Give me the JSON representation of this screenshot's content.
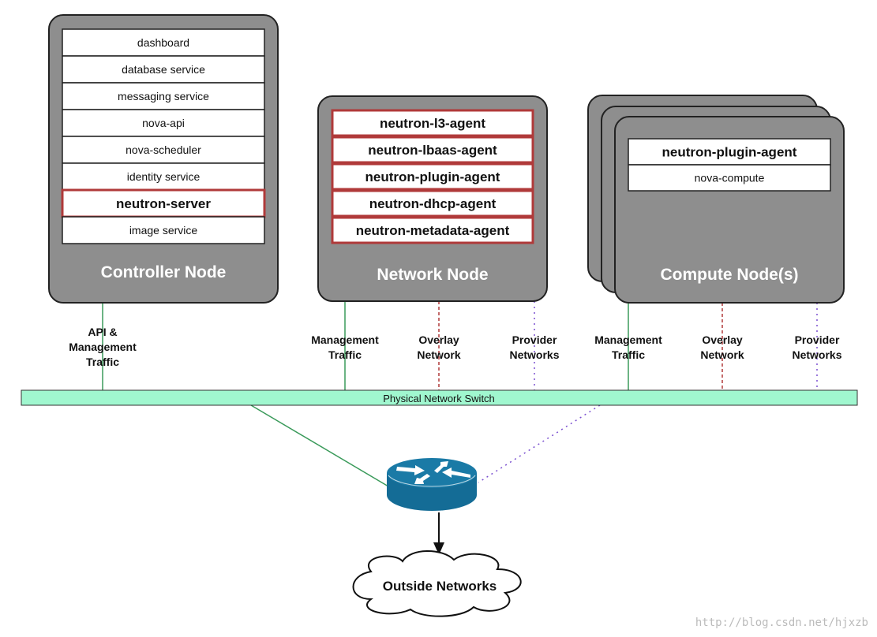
{
  "controller": {
    "title": "Controller Node",
    "services": [
      "dashboard",
      "database service",
      "messaging service",
      "nova-api",
      "nova-scheduler",
      "identity service",
      "neutron-server",
      "image service"
    ],
    "highlighted": [
      "neutron-server"
    ]
  },
  "network": {
    "title": "Network Node",
    "services": [
      "neutron-l3-agent",
      "neutron-lbaas-agent",
      "neutron-plugin-agent",
      "neutron-dhcp-agent",
      "neutron-metadata-agent"
    ]
  },
  "compute": {
    "title": "Compute Node(s)",
    "services": [
      "neutron-plugin-agent",
      "nova-compute"
    ]
  },
  "links": {
    "controller_api": [
      "API &",
      "Management",
      "Traffic"
    ],
    "management": [
      "Management",
      "Traffic"
    ],
    "overlay": [
      "Overlay",
      "Network"
    ],
    "provider": [
      "Provider",
      "Networks"
    ]
  },
  "switch": "Physical Network Switch",
  "outside": "Outside Networks",
  "watermark": "http://blog.csdn.net/hjxzb",
  "colors": {
    "management": "#3a9a5a",
    "overlay": "#b03a3a",
    "provider": "#7a4fd0",
    "switch": "#a0f7cf",
    "router": "#146c96",
    "node": "#8e8e8e"
  }
}
